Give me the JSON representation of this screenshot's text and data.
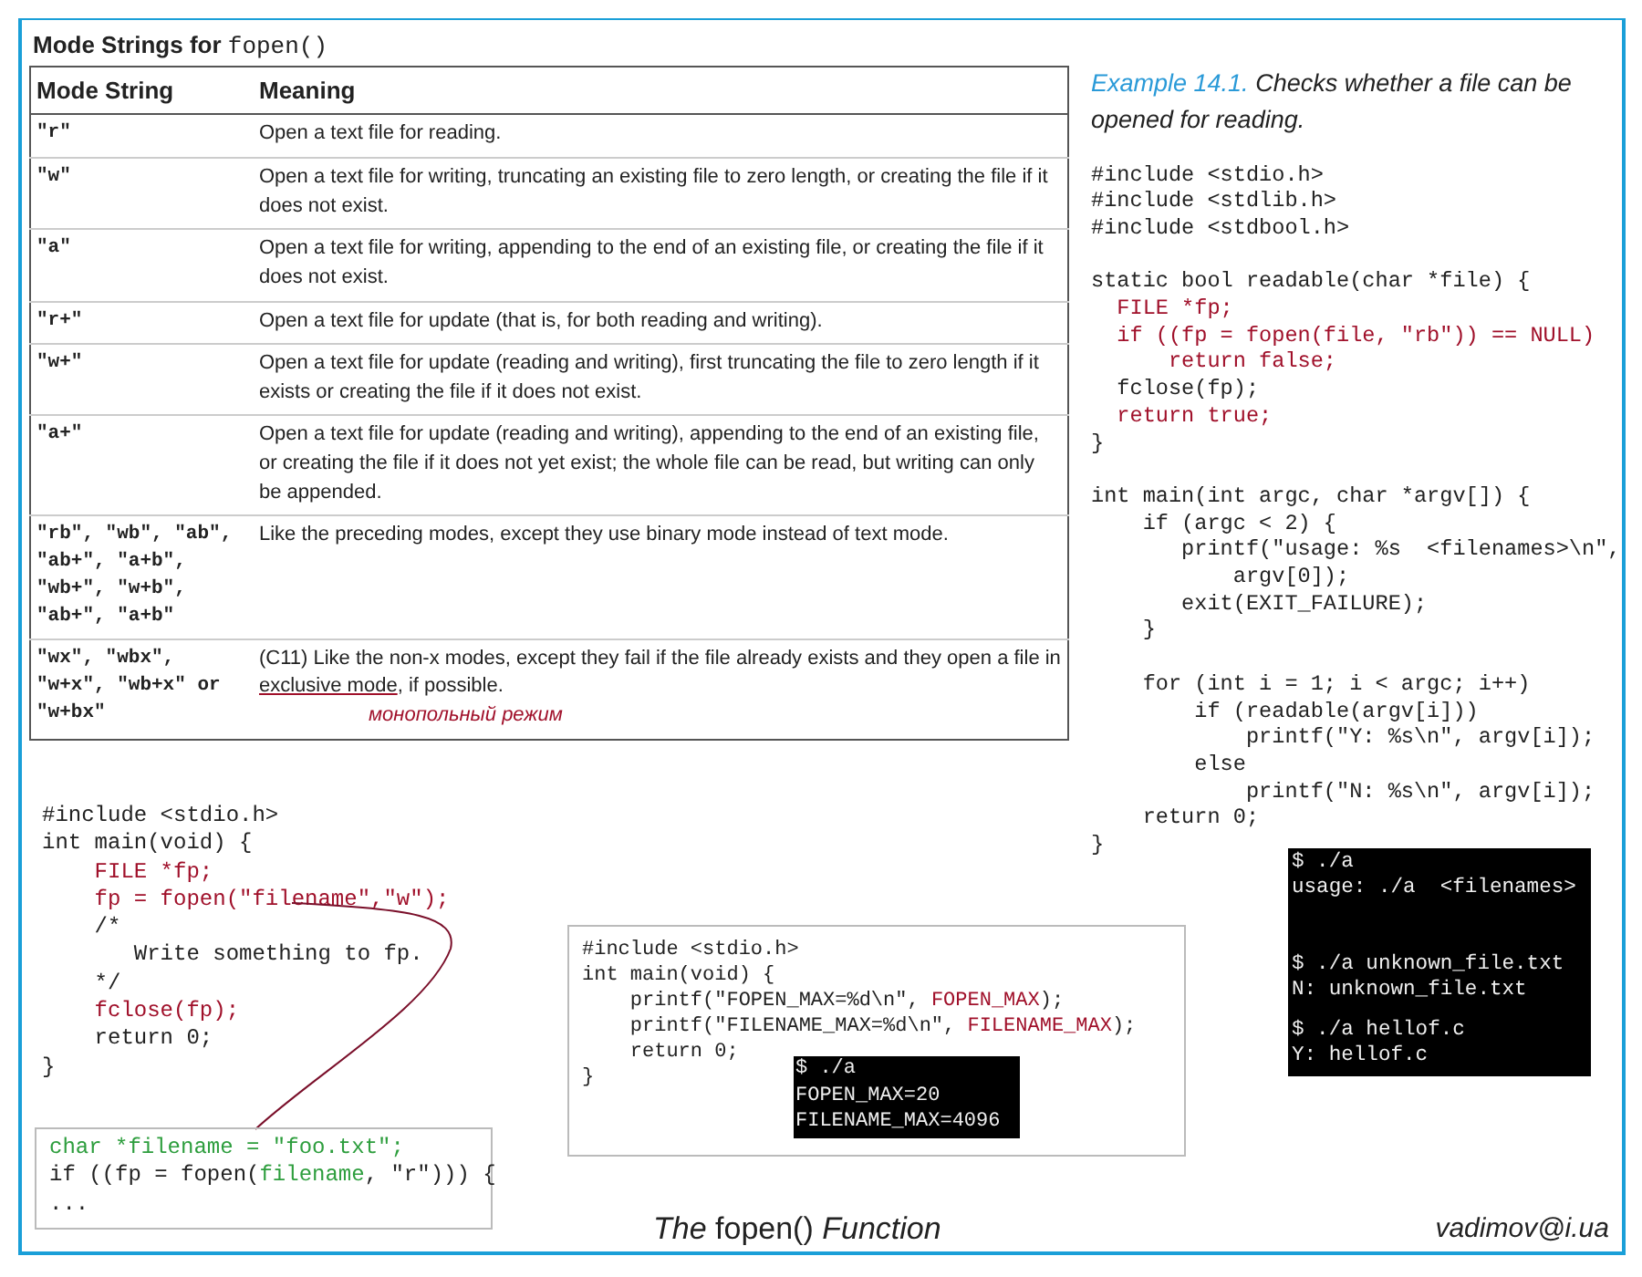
{
  "table": {
    "title": "Mode Strings for ",
    "title_code": "fopen()",
    "columns": [
      "Mode String",
      "Meaning"
    ],
    "rows": [
      {
        "mode": "\"r\"",
        "meaning": "Open a text file for reading."
      },
      {
        "mode": "\"w\"",
        "meaning": "Open a text file for writing, truncating an existing file to zero length, or creating the file if it does not exist."
      },
      {
        "mode": "\"a\"",
        "meaning": "Open a text file for writing, appending to the end of an existing file, or creating the file if it does not exist."
      },
      {
        "mode": "\"r+\"",
        "meaning": "Open a text file for update (that is, for both reading and writing)."
      },
      {
        "mode": "\"w+\"",
        "meaning": "Open a text file for update (reading and writing), first truncating the file to zero length if it exists or creating the file if it does not exist."
      },
      {
        "mode": "\"a+\"",
        "meaning": "Open a text file for update (reading and writing), appending to the end of an existing file, or creating the file if it does not yet exist; the whole file can be read, but writing can only be appended."
      },
      {
        "mode": "\"rb\", \"wb\", \"ab\", \"ab+\", \"a+b\", \"wb+\", \"w+b\", \"ab+\", \"a+b\"",
        "meaning": "Like the preceding modes, except they use binary mode instead of  text mode."
      },
      {
        "mode": "\"wx\", \"wbx\", \"w+x\", \"wb+x\" or \"w+bx\"",
        "meaning": "(C11) Like the non-x modes, except they fail if the file already exists and they open a file in ",
        "term": "exclusive mode",
        "meaning_end": ", if possible.",
        "annotation": "монопольный режим"
      }
    ]
  },
  "example": {
    "label": "Example 14.1.",
    "caption": "Checks whether a file can be opened for reading.",
    "blocks": [
      [
        {
          "segments": [
            {
              "text": "#include <stdio.h>",
              "color": "#222222"
            }
          ]
        },
        {
          "segments": [
            {
              "text": "#include <stdlib.h>",
              "color": "#222222"
            }
          ]
        },
        {
          "segments": [
            {
              "text": "#include <stdbool.h>",
              "color": "#222222"
            }
          ]
        }
      ],
      [
        {
          "segments": [
            {
              "text": "static bool readable(char *file) {",
              "color": "#222222"
            }
          ]
        },
        {
          "segments": [
            {
              "text": "  FILE *fp;",
              "color": "#a0102a"
            }
          ]
        },
        {
          "segments": [
            {
              "text": "  if ((fp = fopen(file, \"rb\")) == NULL)",
              "color": "#a0102a"
            }
          ]
        },
        {
          "segments": [
            {
              "text": "      return false;",
              "color": "#a0102a"
            }
          ]
        },
        {
          "segments": [
            {
              "text": "  fclose(fp);",
              "color": "#222222"
            }
          ]
        },
        {
          "segments": [
            {
              "text": "  return true;",
              "color": "#a0102a"
            }
          ]
        },
        {
          "segments": [
            {
              "text": "}",
              "color": "#222222"
            }
          ]
        }
      ],
      [
        {
          "segments": [
            {
              "text": "int main(int argc, char *argv[]) {",
              "color": "#222222"
            }
          ]
        },
        {
          "segments": [
            {
              "text": "    if (argc < 2) {",
              "color": "#222222"
            }
          ]
        },
        {
          "segments": [
            {
              "text": "       printf(\"usage: %s  <filenames>\\n\",",
              "color": "#222222"
            }
          ]
        },
        {
          "segments": [
            {
              "text": "           argv[0]);",
              "color": "#222222"
            }
          ]
        },
        {
          "segments": [
            {
              "text": "       exit(EXIT_FAILURE);",
              "color": "#222222"
            }
          ]
        },
        {
          "segments": [
            {
              "text": "    }",
              "color": "#222222"
            }
          ]
        }
      ],
      [
        {
          "segments": [
            {
              "text": "    for (int i = 1; i < argc; i++)",
              "color": "#222222"
            }
          ]
        },
        {
          "segments": [
            {
              "text": "        if (readable(argv[i]))",
              "color": "#222222"
            }
          ]
        },
        {
          "segments": [
            {
              "text": "            printf(\"Y: %s\\n\", argv[i]);",
              "color": "#222222"
            }
          ]
        },
        {
          "segments": [
            {
              "text": "        else",
              "color": "#222222"
            }
          ]
        },
        {
          "segments": [
            {
              "text": "            printf(\"N: %s\\n\", argv[i]);",
              "color": "#222222"
            }
          ]
        },
        {
          "segments": [
            {
              "text": "    return 0;",
              "color": "#222222"
            }
          ]
        },
        {
          "segments": [
            {
              "text": "}",
              "color": "#222222"
            }
          ]
        }
      ]
    ]
  },
  "example_output": [
    [
      "$ ./a",
      "usage: ./a  <filenames>"
    ],
    [
      "$ ./a unknown_file.txt",
      "N: unknown_file.txt"
    ],
    [
      "$ ./a hellof.c",
      "Y: hellof.c"
    ]
  ],
  "write_example": {
    "lines": [
      {
        "segments": [
          {
            "text": "#include <stdio.h>",
            "color": "#222222"
          }
        ]
      },
      {
        "segments": [
          {
            "text": "int main(void) {",
            "color": "#222222"
          }
        ]
      },
      {
        "segments": [
          {
            "text": "    FILE *fp;",
            "color": "#a0102a"
          }
        ]
      },
      {
        "segments": [
          {
            "text": "    fp = fopen(\"filename\",\"w\");",
            "color": "#a0102a"
          }
        ]
      },
      {
        "segments": [
          {
            "text": "    /*",
            "color": "#222222"
          }
        ]
      },
      {
        "segments": [
          {
            "text": "       Write something to fp.",
            "color": "#222222"
          }
        ]
      },
      {
        "segments": [
          {
            "text": "    */",
            "color": "#222222"
          }
        ]
      },
      {
        "segments": [
          {
            "text": "    fclose(fp);",
            "color": "#a0102a"
          }
        ]
      },
      {
        "segments": [
          {
            "text": "    return 0;",
            "color": "#222222"
          }
        ]
      },
      {
        "segments": [
          {
            "text": "}",
            "color": "#222222"
          }
        ]
      }
    ],
    "callout": [
      {
        "segments": [
          {
            "text": "char *filename = \"foo.txt\";",
            "color": "#2e9e3e"
          }
        ]
      },
      {
        "segments": [
          {
            "text": "if ((fp = fopen(",
            "color": "#222222"
          },
          {
            "text": "filename",
            "color": "#2e9e3e"
          },
          {
            "text": ", \"r\"))) {",
            "color": "#222222"
          }
        ]
      },
      {
        "segments": [
          {
            "text": "...",
            "color": "#222222"
          }
        ]
      }
    ]
  },
  "limits_example": {
    "lines": [
      {
        "segments": [
          {
            "text": "#include <stdio.h>",
            "color": "#222222"
          }
        ]
      },
      {
        "segments": [
          {
            "text": "int main(void) {",
            "color": "#222222"
          }
        ]
      },
      {
        "segments": [
          {
            "text": "    printf(\"FOPEN_MAX=%d\\n\", ",
            "color": "#222222"
          },
          {
            "text": "FOPEN_MAX",
            "color": "#a0102a"
          },
          {
            "text": ");",
            "color": "#222222"
          }
        ]
      },
      {
        "segments": [
          {
            "text": "    printf(\"FILENAME_MAX=%d\\n\", ",
            "color": "#222222"
          },
          {
            "text": "FILENAME_MAX",
            "color": "#a0102a"
          },
          {
            "text": ");",
            "color": "#222222"
          }
        ]
      },
      {
        "segments": [
          {
            "text": "    return 0;",
            "color": "#222222"
          }
        ]
      },
      {
        "segments": [
          {
            "text": "}",
            "color": "#222222"
          }
        ]
      }
    ],
    "output": [
      "$ ./a",
      "FOPEN_MAX=20",
      "FILENAME_MAX=4096"
    ]
  },
  "footer": {
    "caption": "*The* fopen() *Function*",
    "author": "vadimov@i.ua"
  }
}
